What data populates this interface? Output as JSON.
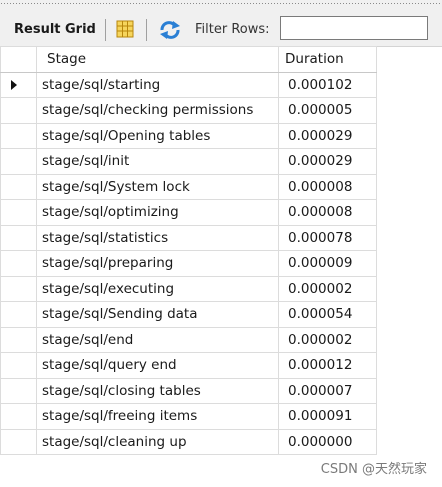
{
  "toolbar": {
    "title": "Result Grid",
    "filter_label": "Filter Rows:",
    "filter_value": "",
    "icons": [
      "grid-view-icon",
      "refresh-icon"
    ]
  },
  "columns": [
    "Stage",
    "Duration"
  ],
  "rows": [
    {
      "stage": "stage/sql/starting",
      "duration": "0.000102"
    },
    {
      "stage": "stage/sql/checking permissions",
      "duration": "0.000005"
    },
    {
      "stage": "stage/sql/Opening tables",
      "duration": "0.000029"
    },
    {
      "stage": "stage/sql/init",
      "duration": "0.000029"
    },
    {
      "stage": "stage/sql/System lock",
      "duration": "0.000008"
    },
    {
      "stage": "stage/sql/optimizing",
      "duration": "0.000008"
    },
    {
      "stage": "stage/sql/statistics",
      "duration": "0.000078"
    },
    {
      "stage": "stage/sql/preparing",
      "duration": "0.000009"
    },
    {
      "stage": "stage/sql/executing",
      "duration": "0.000002"
    },
    {
      "stage": "stage/sql/Sending data",
      "duration": "0.000054"
    },
    {
      "stage": "stage/sql/end",
      "duration": "0.000002"
    },
    {
      "stage": "stage/sql/query end",
      "duration": "0.000012"
    },
    {
      "stage": "stage/sql/closing tables",
      "duration": "0.000007"
    },
    {
      "stage": "stage/sql/freeing items",
      "duration": "0.000091"
    },
    {
      "stage": "stage/sql/cleaning up",
      "duration": "0.000000"
    }
  ],
  "selected_row": 0,
  "watermark": "CSDN @天然玩家"
}
